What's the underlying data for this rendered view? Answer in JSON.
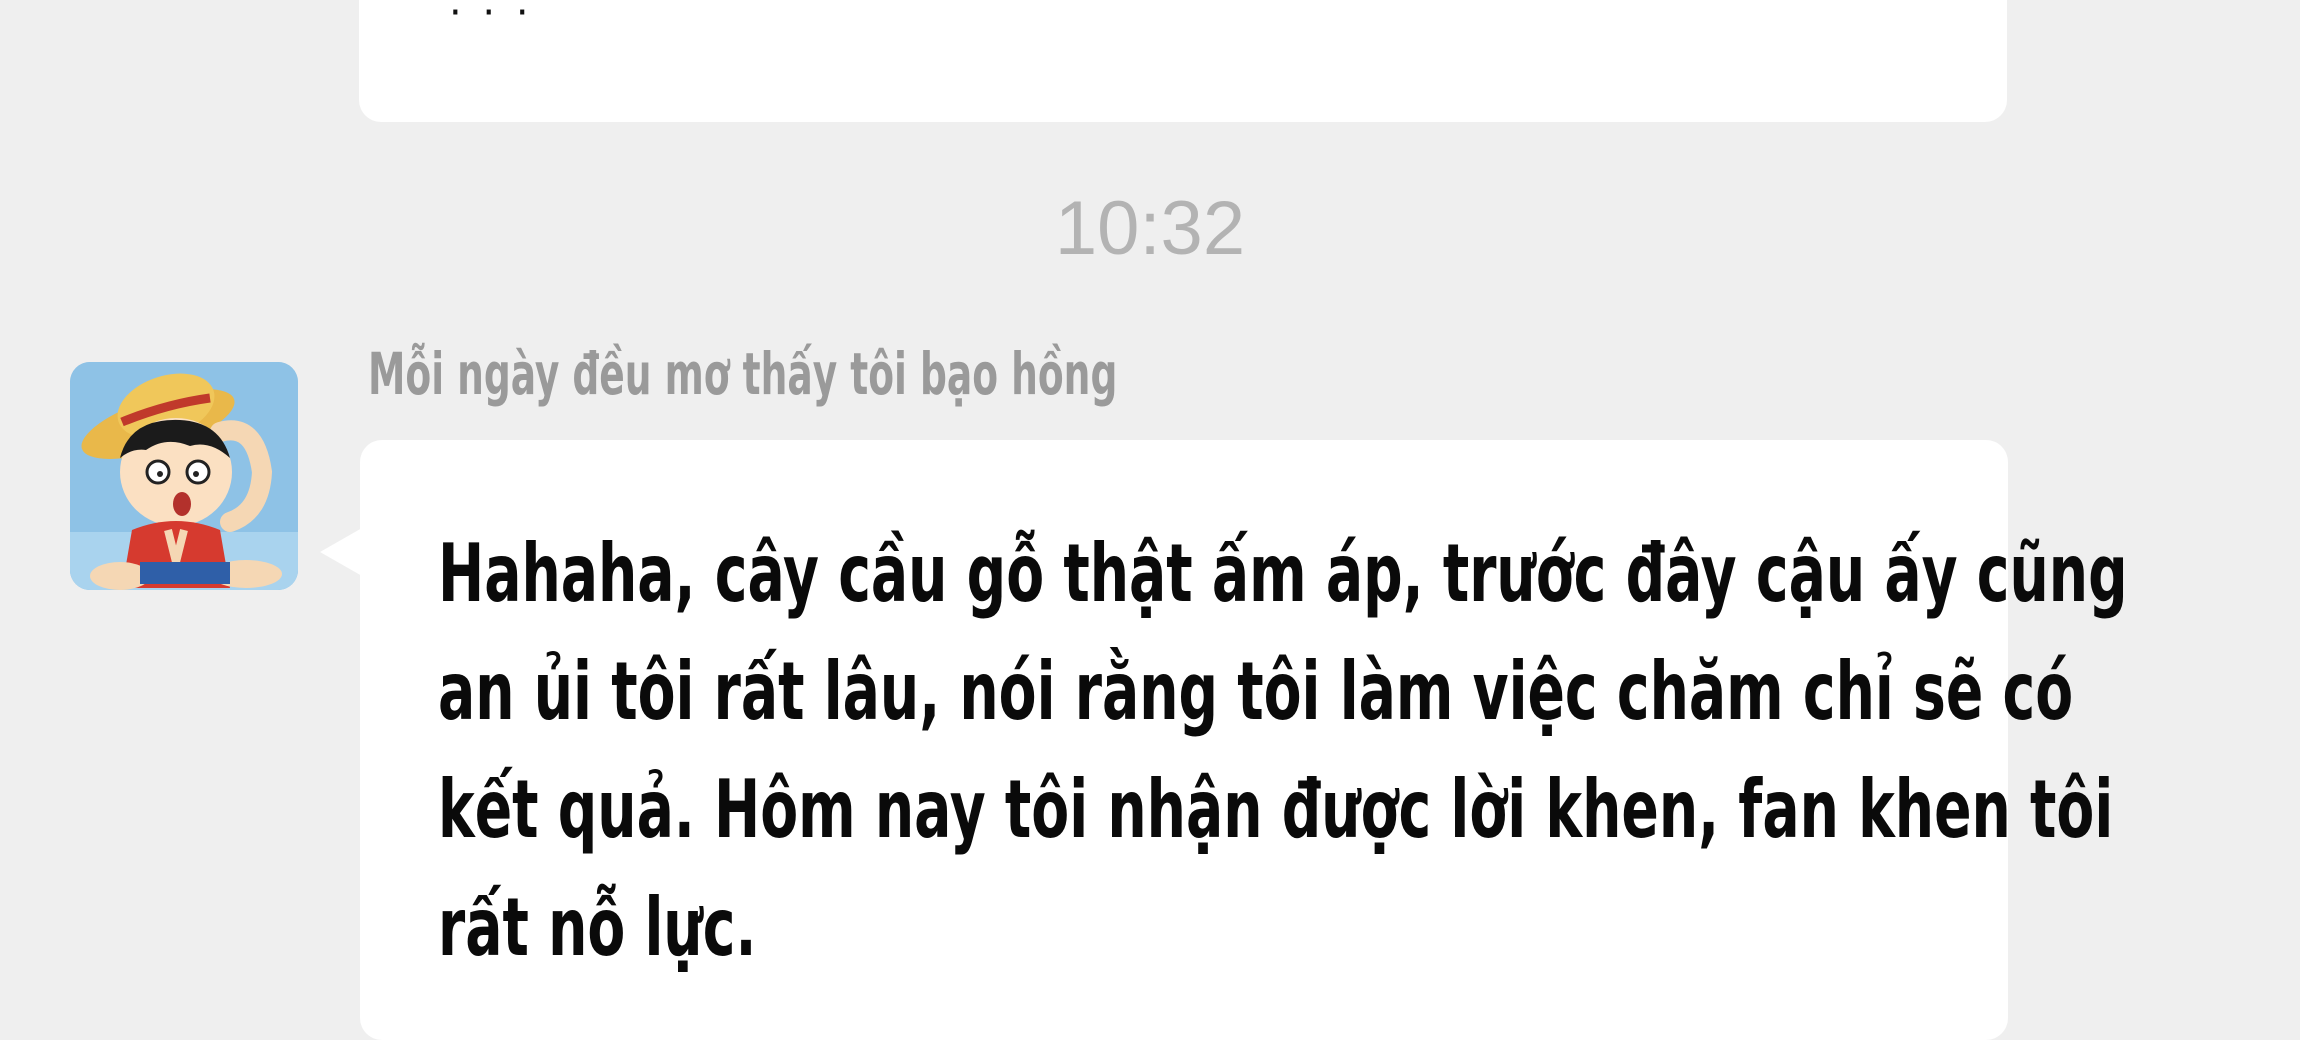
{
  "chat": {
    "previous_message_tail": "· · ·",
    "timestamp": "10:32",
    "message": {
      "sender_name": "Mỗi ngày đều mơ thấy tôi bạo hồng",
      "avatar_icon": "cartoon-boy-straw-hat-avatar",
      "lines": [
        "Hahaha, cây cầu gỗ thật ấm áp, trước đây cậu ấy cũng",
        "an ủi tôi rất lâu, nói rằng tôi làm việc chăm chỉ sẽ có",
        "kết quả. Hôm nay tôi nhận được lời khen, fan khen tôi",
        "rất nỗ lực."
      ]
    }
  },
  "colors": {
    "background": "#efefef",
    "bubble": "#ffffff",
    "timestamp": "#b3b3b3",
    "sender_name": "#9a9a9a",
    "message_text": "#0a0a0a"
  }
}
